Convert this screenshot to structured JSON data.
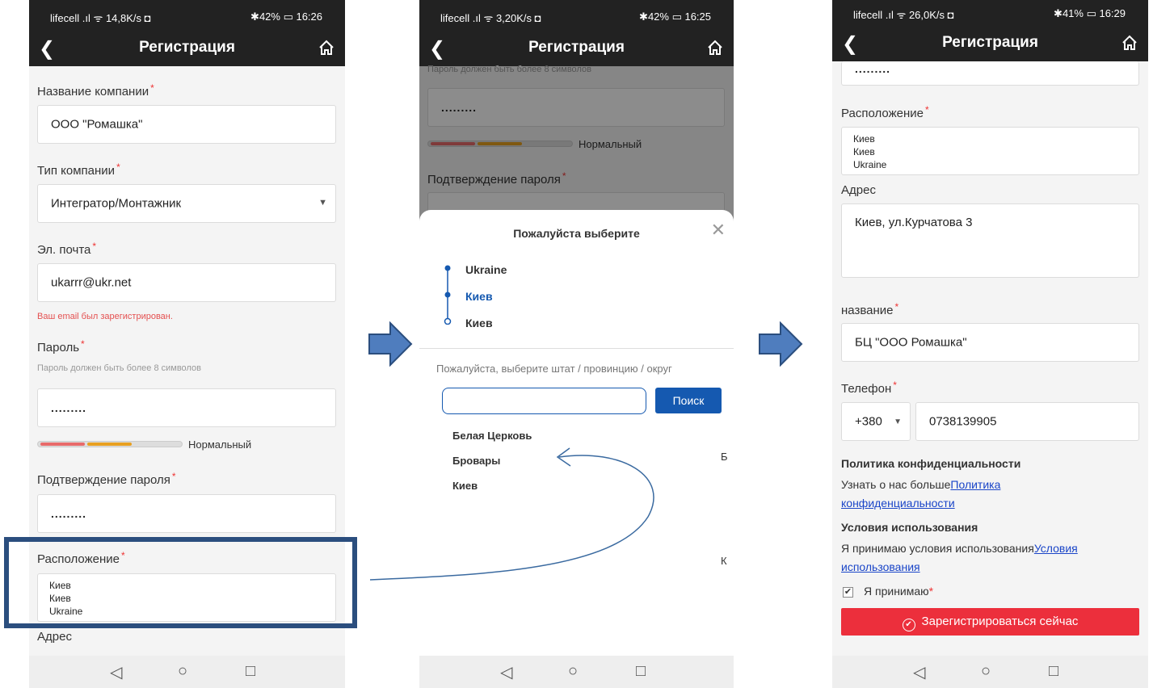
{
  "phone1": {
    "status": {
      "left": "lifecell .ıl ᯤ 14,8K/s ◘",
      "right": "✱42% ▭ 16:26"
    },
    "title": "Регистрация",
    "company_label": "Название компании",
    "company_value": "ООО \"Ромашка\"",
    "type_label": "Тип компании",
    "type_value": "Интегратор/Монтажник",
    "email_label": "Эл. почта",
    "email_value": "ukarrr@ukr.net",
    "email_error": "Ваш email был зарегистрирован.",
    "password_label": "Пароль",
    "password_hint": "Пароль должен быть более 8 символов",
    "password_value": ".........",
    "strength": "Нормальный",
    "confirm_label": "Подтверждение пароля",
    "confirm_value": ".........",
    "location_label": "Расположение",
    "location_lines": [
      "Киев",
      "Киев",
      "Ukraine"
    ],
    "address_label": "Адрес"
  },
  "phone2": {
    "status": {
      "left": "lifecell .ıl ᯤ 3,20K/s ◘",
      "right": "✱42% ▭ 16:25"
    },
    "title": "Регистрация",
    "bg_hint": "Пароль должен быть более 8 символов",
    "bg_password": ".........",
    "bg_strength": "Нормальный",
    "bg_confirm_label": "Подтверждение пароля",
    "sheet_title": "Пожалуйста выберите",
    "steps": [
      "Ukraine",
      "Киев",
      "Киев"
    ],
    "prompt": "Пожалуйста, выберите штат / провинцию / округ",
    "search_button": "Поиск",
    "options": [
      "Белая Церковь",
      "Бровары",
      "Киев"
    ],
    "index_letters": [
      "Б",
      "К"
    ]
  },
  "phone3": {
    "status": {
      "left": "lifecell .ıl ᯤ 26,0K/s ◘",
      "right": "✱41% ▭ 16:29"
    },
    "title": "Регистрация",
    "top_value": ".........",
    "location_label": "Расположение",
    "location_lines": [
      "Киев",
      "Киев",
      "Ukraine"
    ],
    "address_label": "Адрес",
    "address_value": "Киев, ул.Курчатова 3",
    "name_label": "название",
    "name_value": "БЦ \"ООО Ромашка\"",
    "phone_label": "Телефон",
    "phone_code": "+380",
    "phone_value": "0738139905",
    "privacy_title": "Политика конфиденциальности",
    "privacy_text": "Узнать о нас больше",
    "privacy_link1": "Политика",
    "privacy_link2": "конфиденциальности",
    "terms_title": "Условия использования",
    "terms_text": "Я принимаю условия использования",
    "terms_link1": "Условия",
    "terms_link2": "использования",
    "accept_text": "Я принимаю",
    "register_button": "Зарегистрироваться сейчас"
  },
  "colors": {
    "accent_red": "#ec2f3c",
    "link_blue": "#1a45c8",
    "button_blue": "#1559b0",
    "highlight_frame": "#2b4e7e",
    "arrow_blue": "#4f7dbe"
  }
}
